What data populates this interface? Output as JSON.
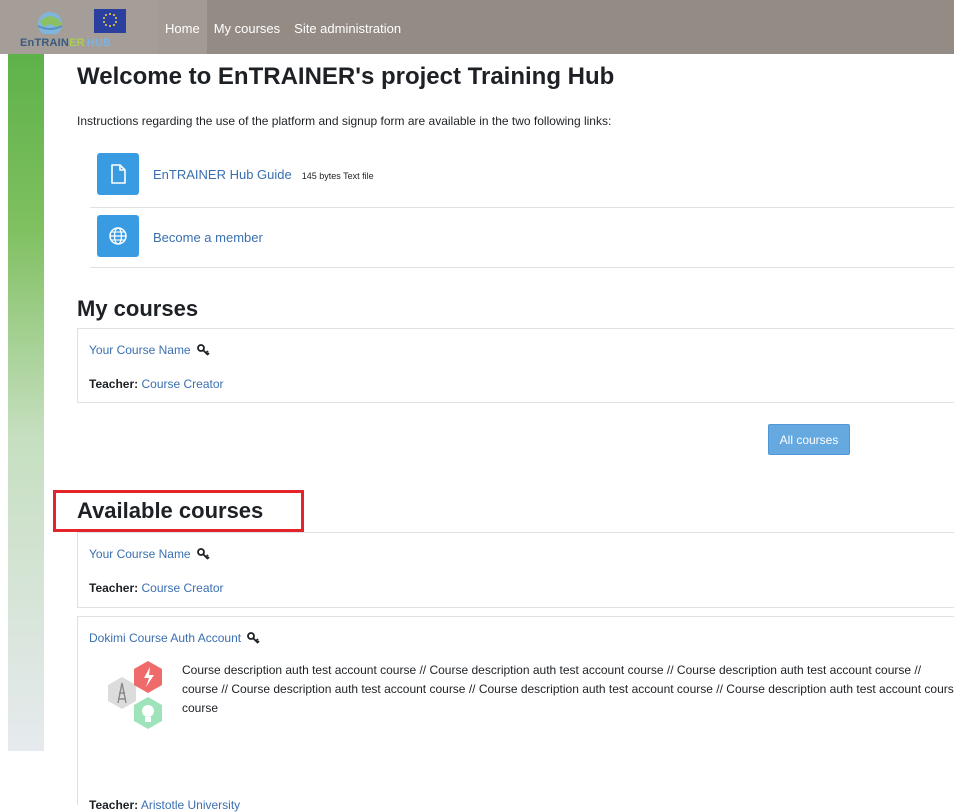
{
  "nav": {
    "brand_part1": "EnTRAIN",
    "brand_part2": "ER",
    "brand_part3": "HUB",
    "links": [
      "Home",
      "My courses",
      "Site administration"
    ]
  },
  "welcome": {
    "title": "Welcome to EnTRAINER's project Training Hub",
    "intro": "Instructions regarding the use of the platform and signup form are available in the two following links:"
  },
  "activities": [
    {
      "label": "EnTRAINER Hub Guide",
      "meta": "145 bytes Text file",
      "icon": "file-icon"
    },
    {
      "label": "Become a member",
      "meta": "",
      "icon": "globe-icon"
    }
  ],
  "my_courses": {
    "heading": "My courses",
    "course_name": "Your Course Name",
    "teacher_label": "Teacher:",
    "teacher_name": "Course Creator",
    "all_courses_button": "All courses"
  },
  "available_courses": {
    "heading": "Available courses",
    "courses": [
      {
        "name": "Your Course Name",
        "teacher_label": "Teacher:",
        "teacher_name": "Course Creator"
      },
      {
        "name": "Dokimi Course Auth Account",
        "description_lines": [
          "Course description auth test account course // Course description auth test account course // Course description auth test account course //",
          "course // Course description auth test account course // Course description auth test account course // Course description auth test account course",
          "course"
        ],
        "teacher_label": "Teacher:",
        "teacher_name": "Aristotle University"
      }
    ]
  },
  "colors": {
    "navbar": "#948b85",
    "link": "#3a6fb0",
    "activity_icon": "#399be2",
    "button": "#66a8e0",
    "highlight": "#e3242b"
  }
}
